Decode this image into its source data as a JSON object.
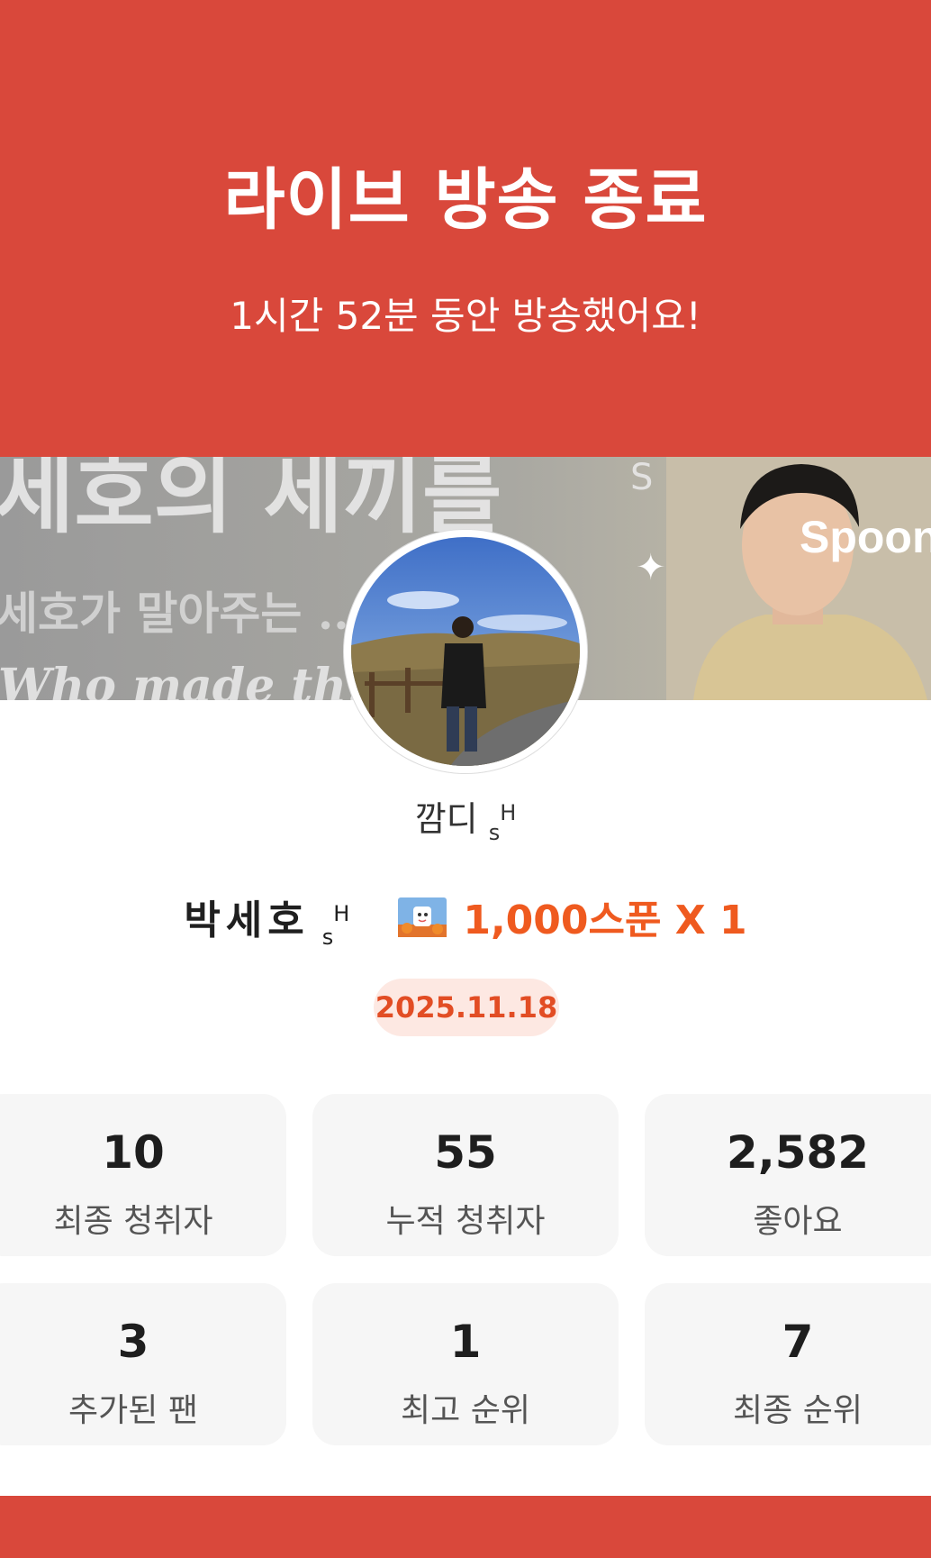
{
  "header": {
    "title": "라이브 방송 종료",
    "subtitle": "1시간 52분 동안 방송했어요!"
  },
  "banner": {
    "line1": "세호의 세끼를",
    "line1_sup": "S",
    "line2": "세호가 말아주는 ... 링",
    "line3": "Who made th... FOOD",
    "brand": "Spoon"
  },
  "profile": {
    "nickname": "깜디",
    "nickname_sub": "s",
    "nickname_sup": "H"
  },
  "gift": {
    "sender": "박세호",
    "sender_sub": "s",
    "sender_sup": "H",
    "amount": "1,000스푼 X 1"
  },
  "date": "2025.11.18",
  "stats": [
    {
      "value": "10",
      "label": "최종 청취자"
    },
    {
      "value": "55",
      "label": "누적 청취자"
    },
    {
      "value": "2,582",
      "label": "좋아요"
    },
    {
      "value": "3",
      "label": "추가된 팬"
    },
    {
      "value": "1",
      "label": "최고 순위"
    },
    {
      "value": "7",
      "label": "최종 순위"
    }
  ],
  "colors": {
    "brand_red": "#d9483b",
    "accent_orange": "#ef5a1f",
    "badge_bg": "#fde8e2",
    "card_bg": "#f6f6f6"
  }
}
